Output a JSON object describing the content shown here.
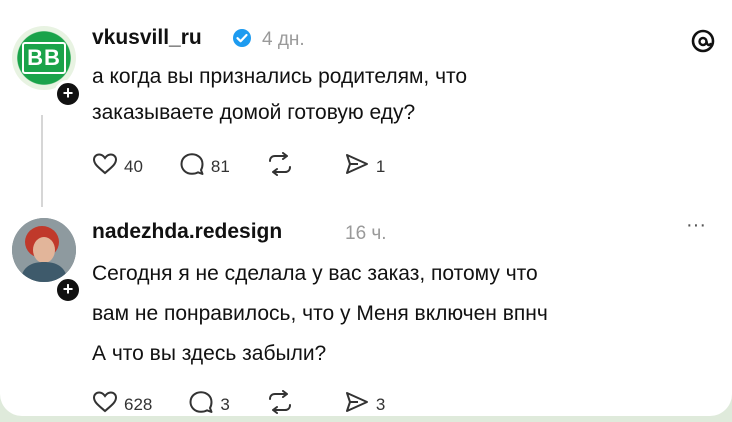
{
  "posts": [
    {
      "username": "vkusvill_ru",
      "verified": true,
      "time": "4 дн.",
      "avatar_text": "BB",
      "text_lines": [
        "а когда вы признались родителям, что",
        "заказываете домой готовую еду?"
      ],
      "likes": "40",
      "comments": "81",
      "shares": "1",
      "corner_icon": "threads-logo-icon"
    },
    {
      "username": "nadezhda.redesign",
      "time": "16 ч.",
      "text_lines": [
        "Сегодня я не сделала у вас заказ, потому что",
        "вам не понравилось, что у Меня включен впнч",
        "А что вы здесь забыли?"
      ],
      "likes": "628",
      "comments": "3",
      "shares": "3",
      "menu": "···"
    }
  ],
  "colors": {
    "background": "#dfeadb",
    "card": "#ffffff",
    "verified": "#1d9bf0"
  }
}
